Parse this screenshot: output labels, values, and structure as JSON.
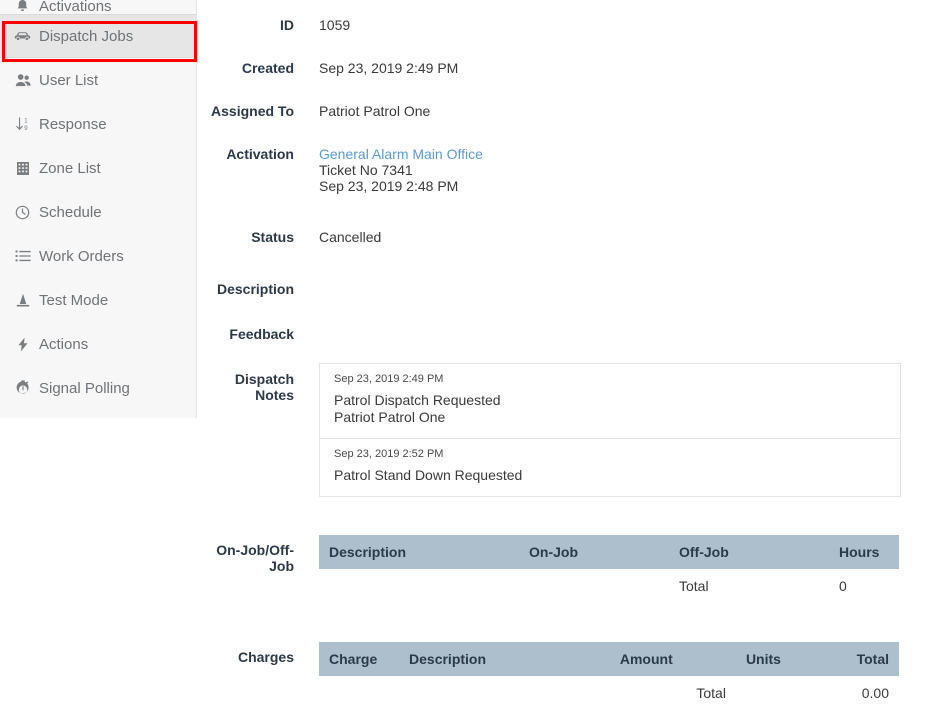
{
  "sidebar": {
    "items": [
      {
        "label": "Activations",
        "icon": "bell-icon",
        "active": false,
        "clipped": true
      },
      {
        "label": "Dispatch Jobs",
        "icon": "car-icon",
        "active": true,
        "clipped": false
      },
      {
        "label": "User List",
        "icon": "users-icon",
        "active": false,
        "clipped": false
      },
      {
        "label": "Response",
        "icon": "sort-numeric-down-icon",
        "active": false,
        "clipped": false
      },
      {
        "label": "Zone List",
        "icon": "building-icon",
        "active": false,
        "clipped": false
      },
      {
        "label": "Schedule",
        "icon": "clock-icon",
        "active": false,
        "clipped": false
      },
      {
        "label": "Work Orders",
        "icon": "task-list-icon",
        "active": false,
        "clipped": false
      },
      {
        "label": "Test Mode",
        "icon": "traffic-cone-icon",
        "active": false,
        "clipped": false
      },
      {
        "label": "Actions",
        "icon": "lightning-bolt-icon",
        "active": false,
        "clipped": false
      },
      {
        "label": "Signal Polling",
        "icon": "stopwatch-icon",
        "active": false,
        "clipped": false
      }
    ],
    "highlight_color": "#ff0000"
  },
  "detail": {
    "id": {
      "label": "ID",
      "value": "1059"
    },
    "created": {
      "label": "Created",
      "value": "Sep 23, 2019 2:49 PM"
    },
    "assigned_to": {
      "label": "Assigned To",
      "value": "Patriot Patrol One"
    },
    "activation": {
      "label": "Activation",
      "link_text": "General Alarm Main Office",
      "link_color": "#5b9bd5",
      "ticket": "Ticket No 7341",
      "time": "Sep 23, 2019 2:48 PM"
    },
    "status": {
      "label": "Status",
      "value": "Cancelled"
    },
    "description": {
      "label": "Description",
      "value": ""
    },
    "feedback": {
      "label": "Feedback",
      "value": ""
    },
    "dispatch_notes": {
      "label": "Dispatch Notes",
      "notes": [
        {
          "time": "Sep 23, 2019 2:49 PM",
          "line1": "Patrol Dispatch Requested",
          "line2": "Patriot Patrol One"
        },
        {
          "time": "Sep 23, 2019 2:52 PM",
          "line1": "Patrol Stand Down Requested",
          "line2": ""
        }
      ]
    },
    "onjob_offjob": {
      "label": "On-Job/Off-Job",
      "columns": [
        "Description",
        "On-Job",
        "Off-Job",
        "Hours"
      ],
      "rows": [],
      "total_label": "Total",
      "total_value": "0"
    },
    "charges": {
      "label": "Charges",
      "columns": [
        "Charge",
        "Description",
        "Amount",
        "Units",
        "Total"
      ],
      "rows": [],
      "total_label": "Total",
      "total_value": "0.00"
    }
  }
}
